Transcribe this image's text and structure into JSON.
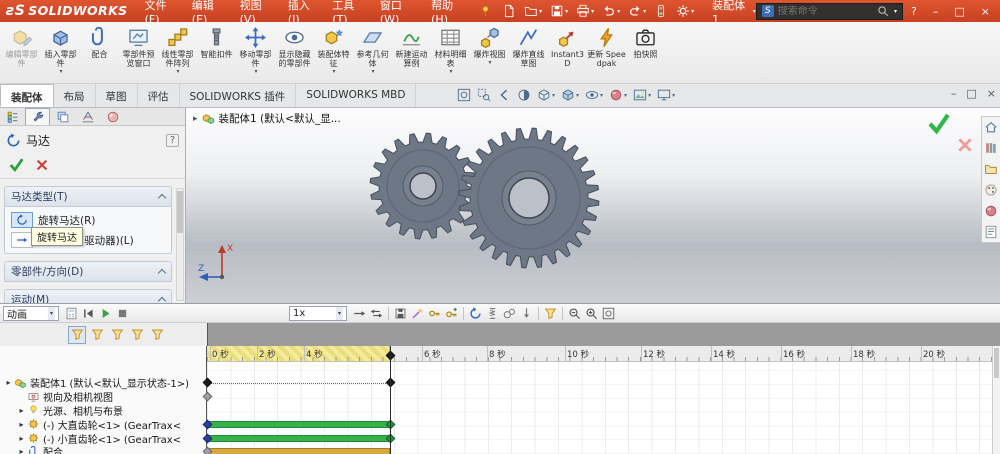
{
  "titlebar": {
    "logo_mark": "ƨS",
    "logo": "SOLIDWORKS",
    "menus": [
      "文件(F)",
      "编辑(E)",
      "视图(V)",
      "插入(I)",
      "工具(T)",
      "窗口(W)",
      "帮助(H)"
    ],
    "quick_icons": [
      {
        "icon": "new-doc-icon"
      },
      {
        "icon": "open-icon",
        "caret": true
      },
      {
        "icon": "save-icon",
        "caret": true
      },
      {
        "icon": "print-icon",
        "caret": true
      },
      {
        "icon": "undo-icon",
        "caret": true
      },
      {
        "icon": "redo-icon",
        "caret": true
      },
      {
        "icon": "rebuild-icon"
      },
      {
        "icon": "options-icon",
        "caret": true
      }
    ],
    "doc_title": "装配体1",
    "search": {
      "placeholder": "搜索命令"
    },
    "help_label": "?",
    "window_controls": {
      "minimize": "–",
      "maximize": "□",
      "close": "×"
    }
  },
  "ribbon": {
    "buttons": [
      {
        "label": "编辑零部件",
        "icon": "edit-component-icon",
        "disabled": true
      },
      {
        "label": "插入零部件",
        "icon": "insert-component-icon",
        "caret": true
      },
      {
        "label": "配合",
        "icon": "mate-icon"
      },
      {
        "label": "零部件预览窗口",
        "icon": "preview-window-icon"
      },
      {
        "label": "线性零部件阵列",
        "icon": "linear-pattern-icon",
        "caret": true
      },
      {
        "label": "智能扣件",
        "icon": "smart-fasteners-icon"
      },
      {
        "label": "移动零部件",
        "icon": "move-component-icon",
        "caret": true
      },
      {
        "label": "显示隐藏的零部件",
        "icon": "show-hidden-icon"
      },
      {
        "label": "装配体特征",
        "icon": "assembly-features-icon",
        "caret": true
      },
      {
        "label": "参考几何体",
        "icon": "reference-geometry-icon",
        "caret": true
      },
      {
        "label": "新建运动算例",
        "icon": "new-motion-study-icon"
      },
      {
        "label": "材料明细表",
        "icon": "bom-icon",
        "caret": true
      },
      {
        "label": "爆炸视图",
        "icon": "exploded-view-icon",
        "caret": true
      },
      {
        "label": "爆炸直线草图",
        "icon": "explode-sketch-icon"
      },
      {
        "label": "Instant3D",
        "icon": "instant3d-icon"
      },
      {
        "label": "更新 Speedpak",
        "icon": "speedpak-icon"
      },
      {
        "label": "拍快照",
        "icon": "snapshot-icon"
      }
    ]
  },
  "tabs": {
    "items": [
      {
        "label": "装配体",
        "active": true
      },
      {
        "label": "布局"
      },
      {
        "label": "草图"
      },
      {
        "label": "评估"
      },
      {
        "label": "SOLIDWORKS 插件"
      },
      {
        "label": "SOLIDWORKS MBD"
      }
    ]
  },
  "headsup": {
    "icons": [
      {
        "icon": "zoom-fit-icon"
      },
      {
        "icon": "zoom-area-icon"
      },
      {
        "icon": "previous-view-icon"
      },
      {
        "icon": "section-view-icon"
      },
      {
        "icon": "view-orientation-icon",
        "caret": true
      },
      {
        "icon": "display-style-icon",
        "caret": true
      },
      {
        "icon": "hide-show-items-icon",
        "caret": true
      },
      {
        "icon": "edit-appearance-icon",
        "caret": true
      },
      {
        "icon": "apply-scene-icon",
        "caret": true
      },
      {
        "icon": "view-settings-icon",
        "caret": true
      }
    ]
  },
  "doc_window_controls": {
    "minimize": "–",
    "restore": "□",
    "close": "×"
  },
  "pm": {
    "tabs": [
      {
        "icon": "fm-tree-icon"
      },
      {
        "icon": "property-manager-icon",
        "active": true
      },
      {
        "icon": "configuration-manager-icon"
      },
      {
        "icon": "dimxpert-manager-icon"
      },
      {
        "icon": "display-manager-icon"
      }
    ],
    "title": "马达",
    "help": "?",
    "tooltip": "旋转马达",
    "groups": {
      "motor_type": {
        "title": "马达类型(T)",
        "items": [
          {
            "label": "旋转马达(R)",
            "icon": "rotary-motor-icon",
            "selected": true
          },
          {
            "label": "线性马达(驱动器)(L)",
            "icon": "linear-motor-icon"
          }
        ]
      },
      "component": {
        "title": "零部件/方向(D)"
      },
      "motion": {
        "title": "运动(M)"
      }
    }
  },
  "viewport": {
    "breadcrumb": "装配体1 (默认<默认_显...",
    "triad": {
      "up": "X",
      "left": "Z"
    }
  },
  "taskpane": {
    "icons": [
      {
        "icon": "sw-resources-icon"
      },
      {
        "icon": "design-library-icon"
      },
      {
        "icon": "file-explorer-icon"
      },
      {
        "icon": "view-palette-icon"
      },
      {
        "icon": "appearances-scenes-icon"
      },
      {
        "icon": "custom-properties-icon"
      }
    ]
  },
  "motion": {
    "study_tab": "动画",
    "speed": "1x",
    "toolbar_left": [
      {
        "icon": "calculate-icon"
      },
      {
        "icon": "play-from-start-icon"
      },
      {
        "icon": "play-icon"
      },
      {
        "icon": "stop-icon"
      }
    ],
    "toolbar_right": [
      {
        "icon": "normal-mode-icon"
      },
      {
        "icon": "reciprocate-mode-icon"
      },
      {
        "sep": true
      },
      {
        "icon": "save-animation-icon"
      },
      {
        "icon": "animation-wizard-icon"
      },
      {
        "icon": "autokey-icon"
      },
      {
        "icon": "add-key-icon"
      },
      {
        "sep": true
      },
      {
        "icon": "motor-icon"
      },
      {
        "icon": "spring-icon"
      },
      {
        "icon": "contact-icon"
      },
      {
        "icon": "gravity-icon"
      },
      {
        "sep": true
      },
      {
        "icon": "filter-icon"
      },
      {
        "sep": true
      },
      {
        "icon": "zoom-out-icon"
      },
      {
        "icon": "zoom-in-icon"
      },
      {
        "icon": "zoom-fit-icon"
      }
    ],
    "filters": [
      {
        "icon": "filter-none-icon",
        "pressed": true
      },
      {
        "icon": "filter-animated-icon"
      },
      {
        "icon": "filter-driving-icon"
      },
      {
        "icon": "filter-selected-icon"
      },
      {
        "icon": "filter-results-icon"
      }
    ],
    "ruler_labels": [
      "0 秒",
      "2 秒",
      "4 秒",
      "6 秒",
      "8 秒",
      "10 秒",
      "12 秒",
      "14 秒",
      "16 秒",
      "18 秒",
      "20 秒"
    ],
    "tree": [
      {
        "label": "装配体1 (默认<默认_显示状态-1>)",
        "icon": "assembly-icon",
        "expand": true,
        "indent": 0,
        "key_start": "black",
        "key_end": "black",
        "connector": true
      },
      {
        "label": "视向及相机视图",
        "icon": "orientation-icon",
        "indent": 1,
        "key_start": "gray"
      },
      {
        "label": "光源、相机与布景",
        "icon": "lights-icon",
        "expand": true,
        "indent": 1
      },
      {
        "label": "(-) 大直齿轮<1> (GearTrax<",
        "icon": "part-icon",
        "expand": true,
        "indent": 1,
        "key_start": "blue",
        "bar": "green",
        "key_end": "green"
      },
      {
        "label": "(-) 小直齿轮<1> (GearTrax<",
        "icon": "part-icon",
        "expand": true,
        "indent": 1,
        "key_start": "blue",
        "bar": "green",
        "key_end": "green"
      },
      {
        "label": "配合",
        "icon": "mates-icon",
        "expand": true,
        "indent": 1,
        "key_start": "gray",
        "bar": "gold"
      }
    ]
  }
}
